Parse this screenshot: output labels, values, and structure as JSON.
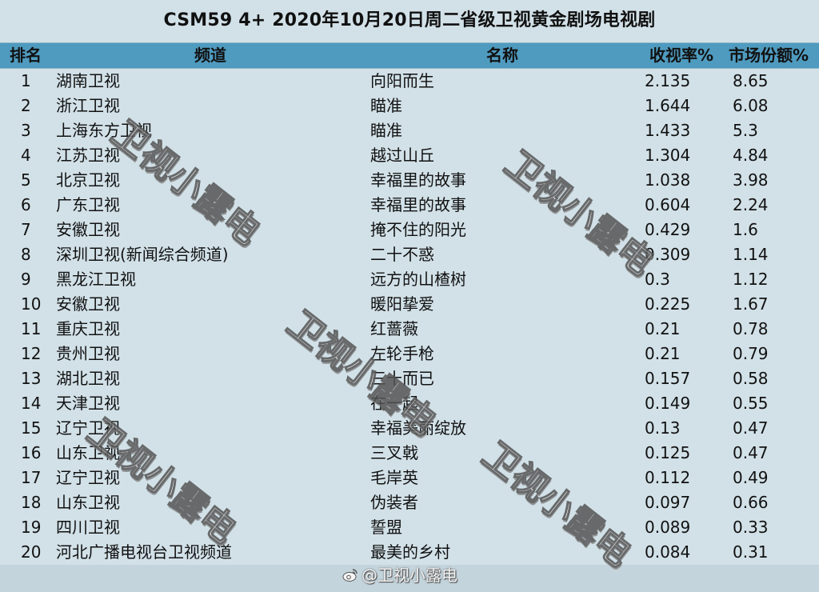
{
  "title": "CSM59 4+ 2020年10月20日周二省级卫视黄金剧场电视剧",
  "headers": {
    "rank": "排名",
    "channel": "频道",
    "name": "名称",
    "rating": "收视率%",
    "share": "市场份额%"
  },
  "rows": [
    {
      "rank": "1",
      "channel": "湖南卫视",
      "name": "向阳而生",
      "rating": "2.135",
      "share": "8.65"
    },
    {
      "rank": "2",
      "channel": "浙江卫视",
      "name": "瞄准",
      "rating": "1.644",
      "share": "6.08"
    },
    {
      "rank": "3",
      "channel": "上海东方卫视",
      "name": "瞄准",
      "rating": "1.433",
      "share": "5.3"
    },
    {
      "rank": "4",
      "channel": "江苏卫视",
      "name": "越过山丘",
      "rating": "1.304",
      "share": "4.84"
    },
    {
      "rank": "5",
      "channel": "北京卫视",
      "name": "幸福里的故事",
      "rating": "1.038",
      "share": "3.98"
    },
    {
      "rank": "6",
      "channel": "广东卫视",
      "name": "幸福里的故事",
      "rating": "0.604",
      "share": "2.24"
    },
    {
      "rank": "7",
      "channel": "安徽卫视",
      "name": "掩不住的阳光",
      "rating": "0.429",
      "share": "1.6"
    },
    {
      "rank": "8",
      "channel": "深圳卫视(新闻综合频道)",
      "name": "二十不惑",
      "rating": "0.309",
      "share": "1.14"
    },
    {
      "rank": "9",
      "channel": "黑龙江卫视",
      "name": "远方的山楂树",
      "rating": "0.3",
      "share": "1.12"
    },
    {
      "rank": "10",
      "channel": "安徽卫视",
      "name": "暖阳挚爱",
      "rating": "0.225",
      "share": "1.67"
    },
    {
      "rank": "11",
      "channel": "重庆卫视",
      "name": "红蔷薇",
      "rating": "0.21",
      "share": "0.78"
    },
    {
      "rank": "12",
      "channel": "贵州卫视",
      "name": "左轮手枪",
      "rating": "0.21",
      "share": "0.79"
    },
    {
      "rank": "13",
      "channel": "湖北卫视",
      "name": "三十而已",
      "rating": "0.157",
      "share": "0.58"
    },
    {
      "rank": "14",
      "channel": "天津卫视",
      "name": "在一起",
      "rating": "0.149",
      "share": "0.55"
    },
    {
      "rank": "15",
      "channel": "辽宁卫视",
      "name": "幸福美丽绽放",
      "rating": "0.13",
      "share": "0.47"
    },
    {
      "rank": "16",
      "channel": "山东卫视",
      "name": "三叉戟",
      "rating": "0.125",
      "share": "0.47"
    },
    {
      "rank": "17",
      "channel": "辽宁卫视",
      "name": "毛岸英",
      "rating": "0.112",
      "share": "0.49"
    },
    {
      "rank": "18",
      "channel": "山东卫视",
      "name": "伪装者",
      "rating": "0.097",
      "share": "0.66"
    },
    {
      "rank": "19",
      "channel": "四川卫视",
      "name": "誓盟",
      "rating": "0.089",
      "share": "0.33"
    },
    {
      "rank": "20",
      "channel": "河北广播电视台卫视频道",
      "name": "最美的乡村",
      "rating": "0.084",
      "share": "0.31"
    }
  ],
  "watermark_text": "卫视小露电",
  "handle": "@卫视小露电",
  "icon": "weibo-icon",
  "colors": {
    "background": "#d2e1e8",
    "header": "#4f9bc0"
  }
}
